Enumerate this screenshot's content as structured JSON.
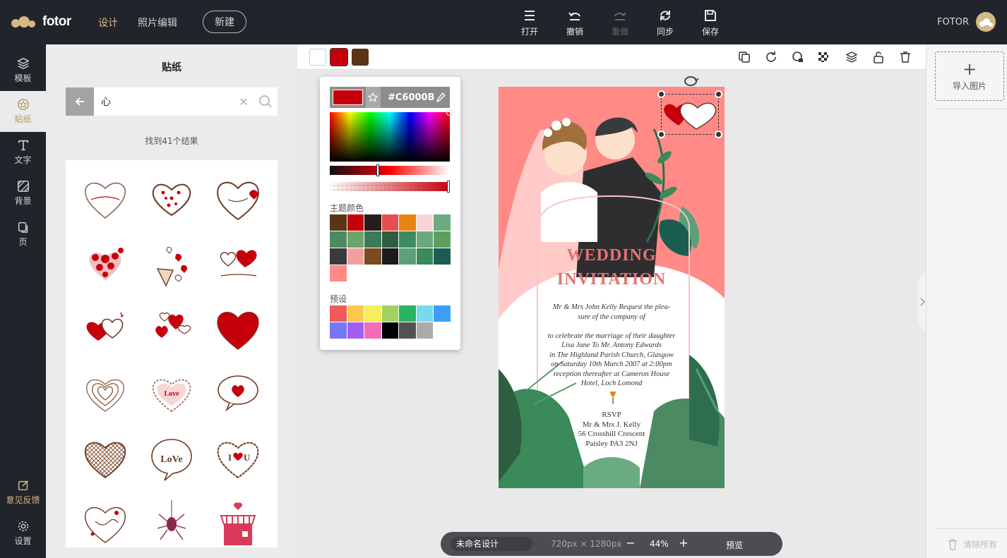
{
  "app": {
    "logo_text": "fotor",
    "nav": [
      {
        "label": "设计",
        "active": true
      },
      {
        "label": "照片编辑",
        "active": false
      }
    ],
    "new_button": "新建",
    "actions": [
      {
        "label": "打开",
        "icon": "menu-icon",
        "enabled": true
      },
      {
        "label": "撤销",
        "icon": "undo-icon",
        "enabled": true
      },
      {
        "label": "重做",
        "icon": "redo-icon",
        "enabled": false
      },
      {
        "label": "同步",
        "icon": "sync-icon",
        "enabled": true
      },
      {
        "label": "保存",
        "icon": "save-icon",
        "enabled": true
      }
    ],
    "user_name": "FOTOR"
  },
  "rail": {
    "items": [
      {
        "label": "模板",
        "icon": "layers-icon"
      },
      {
        "label": "贴纸",
        "icon": "sticker-icon",
        "active": true
      },
      {
        "label": "文字",
        "icon": "text-icon"
      },
      {
        "label": "背景",
        "icon": "background-icon"
      },
      {
        "label": "页",
        "icon": "page-icon"
      }
    ],
    "feedback": "意见反馈",
    "settings": "设置"
  },
  "sticker_panel": {
    "title": "贴纸",
    "search_value": "心",
    "result_count": "找到41个结果",
    "stickers": [
      "heart-outline-i-love-you",
      "heart-dotted",
      "heart-i-love-you",
      "heart-cluster",
      "heart-cone",
      "heart-swirl-i-love-you",
      "heart-pair",
      "heart-scatter",
      "heart-big-red",
      "heart-spiral",
      "heart-love-badge",
      "heart-speech-bubble",
      "heart-crosshatch",
      "heart-love-bubble",
      "heart-i-love-u",
      "heart-flourish",
      "spider-ornament",
      "gift-shop"
    ]
  },
  "context_bar": {
    "swatches": [
      "#ffffff",
      "#c6000b",
      "#5a3416"
    ],
    "tools": [
      "copy-icon",
      "rotate-icon",
      "shape-icon",
      "transparency-icon",
      "layers-icon",
      "unlock-icon",
      "delete-icon"
    ]
  },
  "color_picker": {
    "current_color": "#C6000B",
    "hex_label": "#C6000B",
    "shade_position": 0.4,
    "alpha": 1.0,
    "theme_label": "主题颜色",
    "theme_colors": [
      "#5a3416",
      "#c6000b",
      "#2a1c1c",
      "#e84e4e",
      "#e88412",
      "#f8d6d6",
      "#6aab82",
      "#4b8a62",
      "#6ca566",
      "#3c7a5a",
      "#2e5e40",
      "#3f8a62",
      "#6aa87e",
      "#5e9e5e",
      "#3a3a3a",
      "#f0a0a0",
      "#7a4a22",
      "#1c1a1a",
      "#5aa07a",
      "#3a8a5a",
      "#1a5e52",
      "#ff8a86"
    ],
    "preset_label": "预设",
    "preset_colors": [
      "#f05a5a",
      "#fec84c",
      "#f6ee5a",
      "#a2d260",
      "#2cb264",
      "#74dcec",
      "#3e9ef6",
      "#7478f8",
      "#a25ef2",
      "#f26cb8",
      "#000000",
      "#525252",
      "#aaaaaa"
    ]
  },
  "design": {
    "title_line1": "WEDDING",
    "title_line2": "INVITATION",
    "body": [
      "Mr & Mrs John Kelly  Request the plea-",
      "sure of the company of",
      "",
      "to celebrate the marriage of their daughter",
      "Lisa Jane To  Mr. Antony Edwards",
      "in The Highland Parish Church, Glasgow",
      "on Saturday 10th March 2007  at 2:00pm",
      "reception thereafter at Cameron House",
      "Hotel,  Loch Lomond"
    ],
    "rsvp": [
      "RSVP",
      "Mr & Mrs J. Kelly",
      "56 Crosshill Crescent",
      "Paisley PA3 2NJ"
    ]
  },
  "bottom_bar": {
    "design_name": "未命名设计",
    "dimensions": "720px × 1280px",
    "zoom_out": "−",
    "zoom_level": "44%",
    "zoom_in": "+",
    "preview": "预览"
  },
  "right_panel": {
    "import_label": "导入图片",
    "clear_all": "清除所有"
  }
}
